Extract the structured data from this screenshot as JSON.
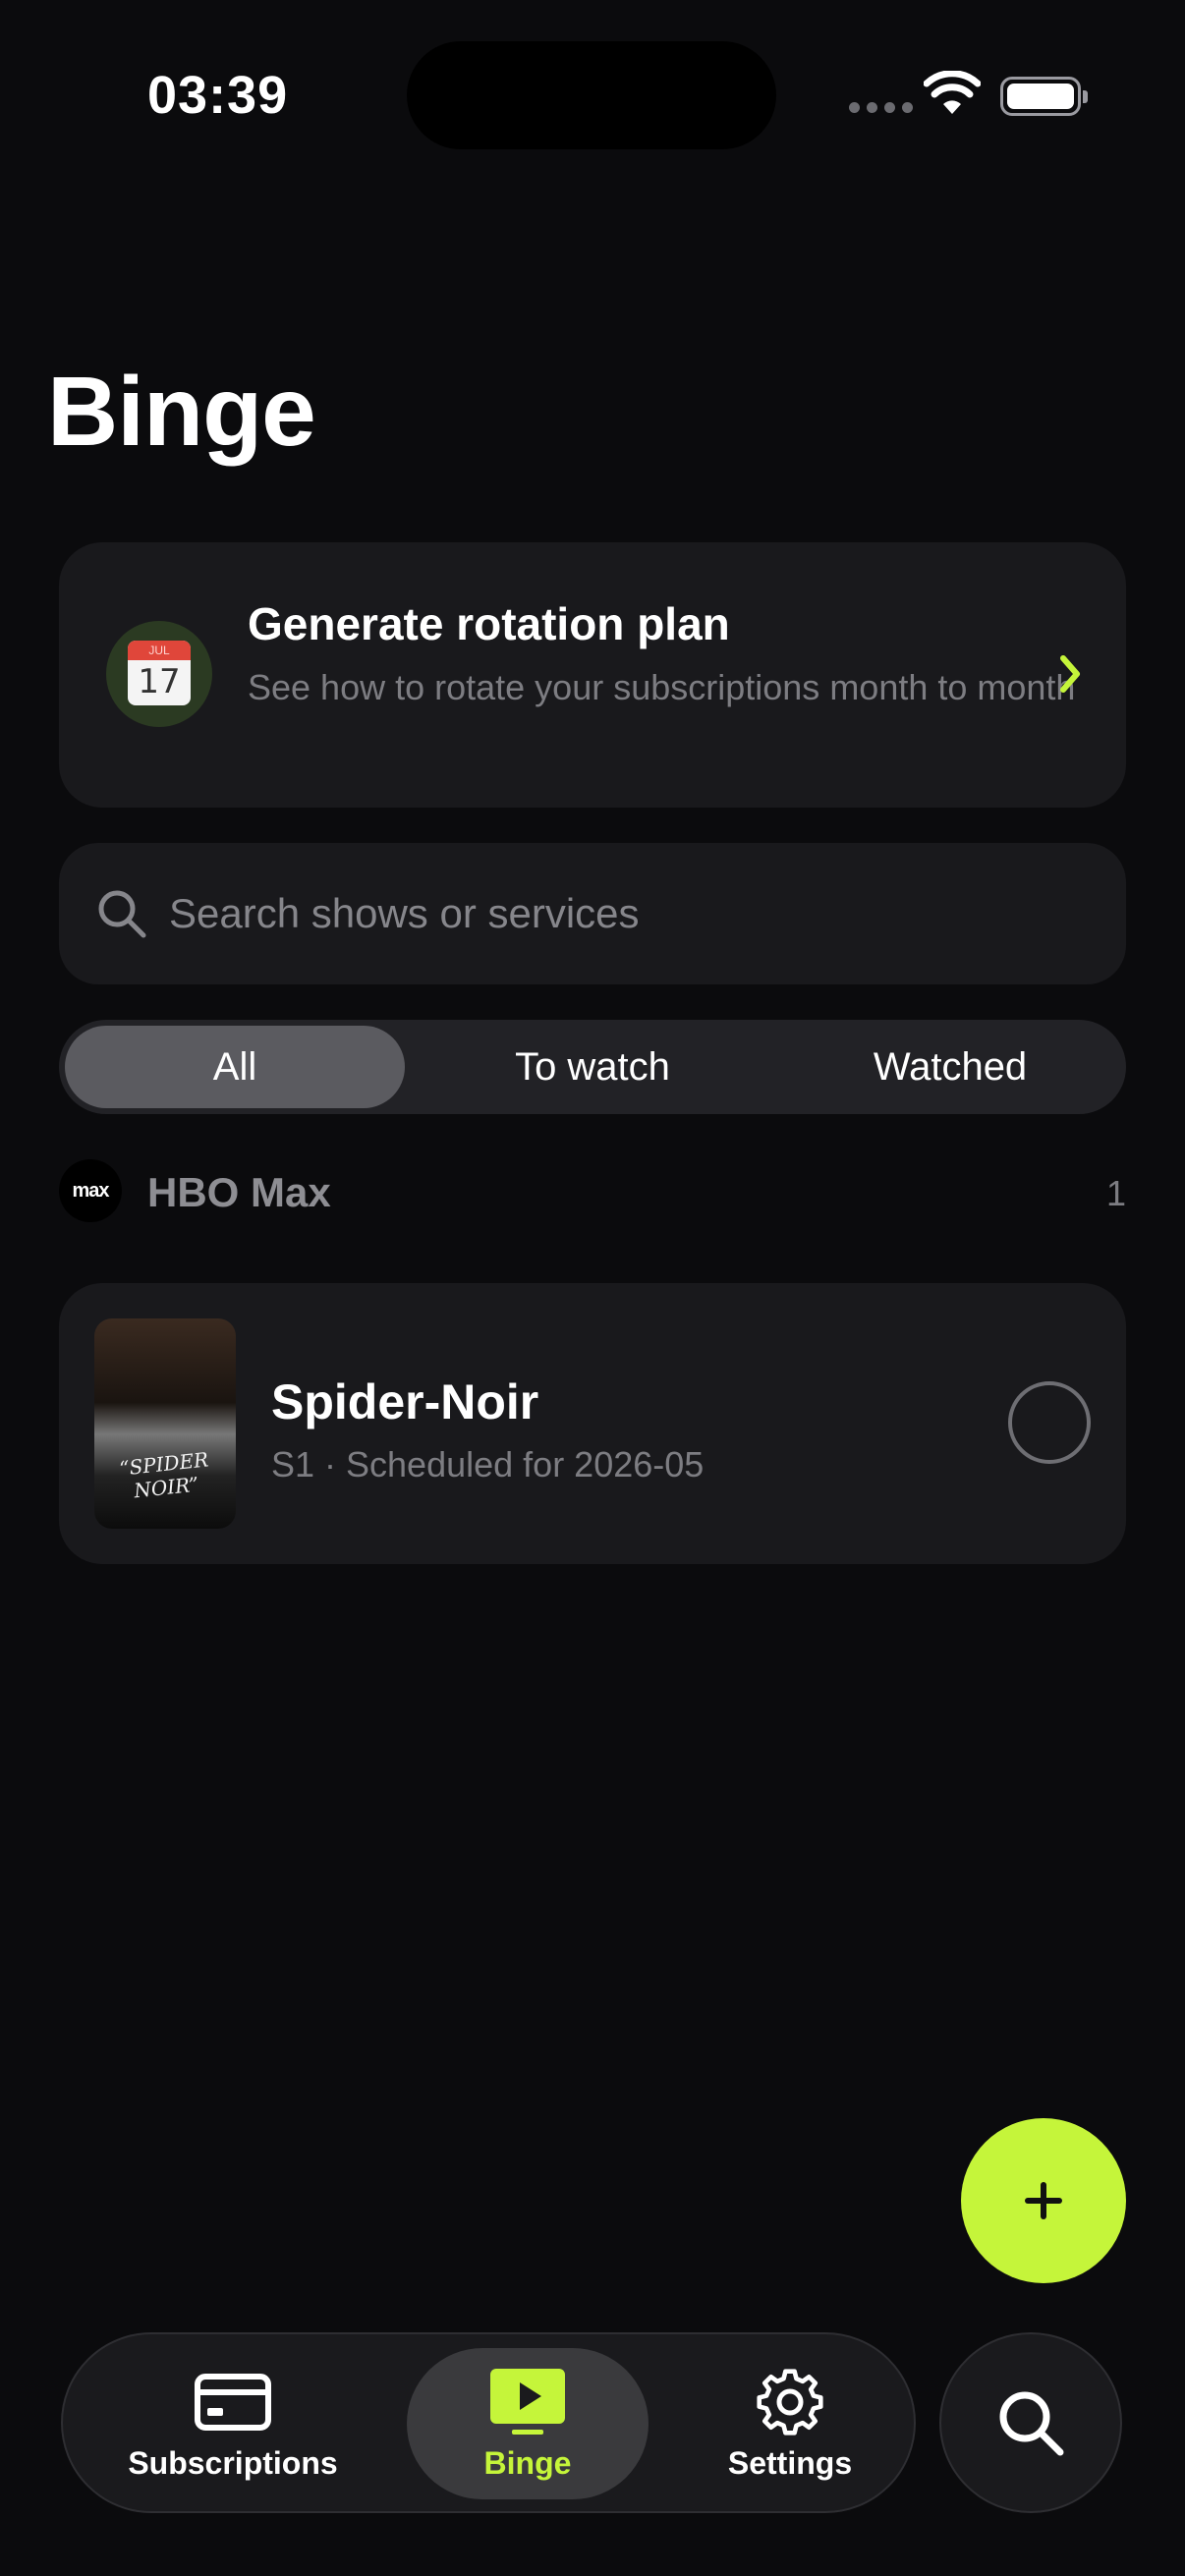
{
  "status_bar": {
    "time": "03:39"
  },
  "page": {
    "title": "Binge"
  },
  "rotation_card": {
    "calendar_month": "JUL",
    "calendar_day": "17",
    "title": "Generate rotation plan",
    "subtitle": "See how to rotate your subscriptions month to month"
  },
  "search": {
    "placeholder": "Search shows or services",
    "value": ""
  },
  "filter": {
    "options": [
      "All",
      "To watch",
      "Watched"
    ],
    "selected": "All"
  },
  "service_group": {
    "logo_text": "max",
    "name": "HBO Max",
    "count": "1"
  },
  "show": {
    "poster_text": "“SPIDER NOIR”",
    "title": "Spider-Noir",
    "subtitle": "S1 · Scheduled for 2026-05",
    "watched": false
  },
  "tabbar": {
    "tabs": [
      {
        "label": "Subscriptions",
        "icon": "card-icon"
      },
      {
        "label": "Binge",
        "icon": "tv-play-icon"
      },
      {
        "label": "Settings",
        "icon": "gear-icon"
      }
    ],
    "selected": "Binge"
  },
  "colors": {
    "accent": "#c5f53a",
    "background": "#0b0b0d",
    "card": "#19191c"
  }
}
